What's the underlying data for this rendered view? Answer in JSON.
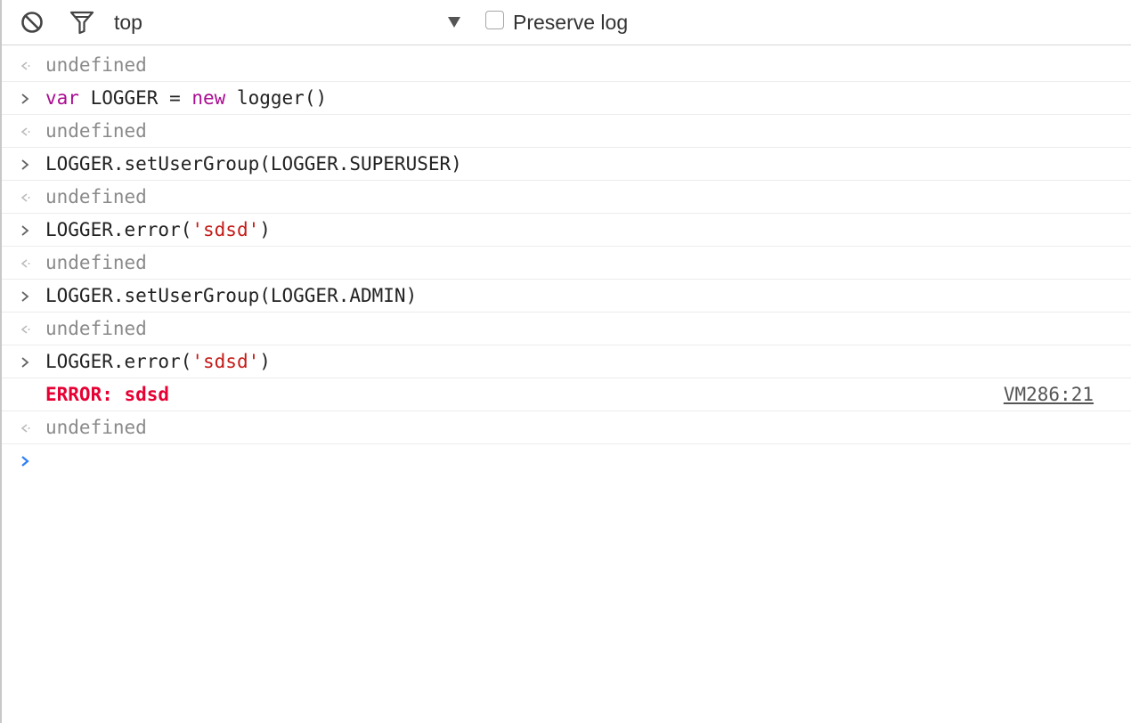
{
  "toolbar": {
    "context": "top",
    "preserve_log_label": "Preserve log",
    "preserve_log_checked": false
  },
  "console": {
    "rows": [
      {
        "kind": "result",
        "text": "undefined"
      },
      {
        "kind": "command",
        "parts": [
          "var",
          " LOGGER = ",
          "new",
          " logger()"
        ]
      },
      {
        "kind": "result",
        "text": "undefined"
      },
      {
        "kind": "command",
        "text": "LOGGER.setUserGroup(LOGGER.SUPERUSER)"
      },
      {
        "kind": "result",
        "text": "undefined"
      },
      {
        "kind": "command",
        "parts": [
          "LOGGER.error(",
          "'sdsd'",
          ")"
        ]
      },
      {
        "kind": "result",
        "text": "undefined"
      },
      {
        "kind": "command",
        "text": "LOGGER.setUserGroup(LOGGER.ADMIN)"
      },
      {
        "kind": "result",
        "text": "undefined"
      },
      {
        "kind": "command",
        "parts": [
          "LOGGER.error(",
          "'sdsd'",
          ")"
        ]
      },
      {
        "kind": "error",
        "text": "ERROR: sdsd",
        "source": "VM286:21"
      },
      {
        "kind": "result",
        "text": "undefined"
      }
    ]
  },
  "colors": {
    "keyword": "#aa0d91",
    "string": "#c41a16",
    "error": "#e60033",
    "prompt": "#2d7ff9"
  }
}
